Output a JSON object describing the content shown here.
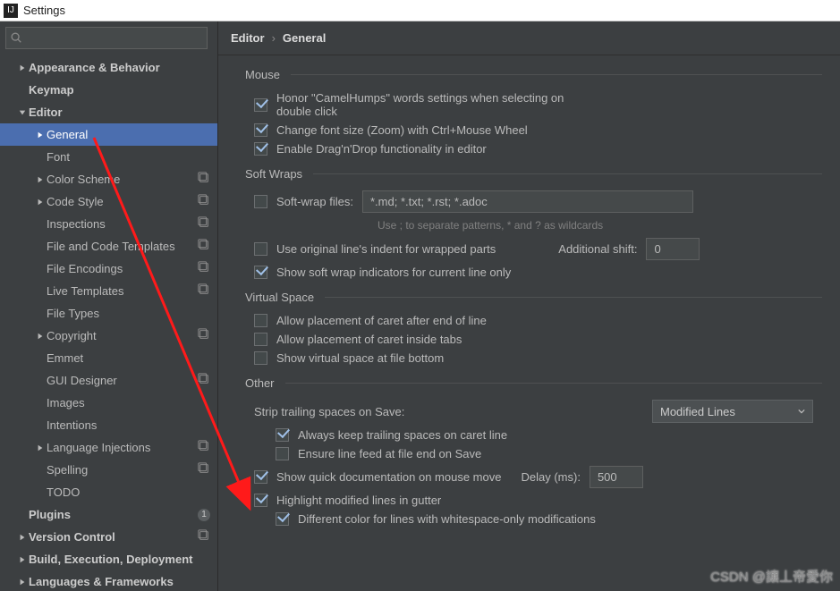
{
  "window": {
    "title": "Settings"
  },
  "search": {
    "placeholder": ""
  },
  "sidebar": {
    "items": [
      {
        "label": "Appearance & Behavior",
        "arrow": "right",
        "bold": true,
        "indent": 0
      },
      {
        "label": "Keymap",
        "bold": true,
        "indent": 0
      },
      {
        "label": "Editor",
        "arrow": "down",
        "bold": true,
        "indent": 0
      },
      {
        "label": "General",
        "arrow": "right",
        "indent": 1,
        "selected": true
      },
      {
        "label": "Font",
        "indent": 1
      },
      {
        "label": "Color Scheme",
        "arrow": "right",
        "indent": 1,
        "tag": true
      },
      {
        "label": "Code Style",
        "arrow": "right",
        "indent": 1,
        "tag": true
      },
      {
        "label": "Inspections",
        "indent": 1,
        "tag": true
      },
      {
        "label": "File and Code Templates",
        "indent": 1,
        "tag": true
      },
      {
        "label": "File Encodings",
        "indent": 1,
        "tag": true
      },
      {
        "label": "Live Templates",
        "indent": 1,
        "tag": true
      },
      {
        "label": "File Types",
        "indent": 1
      },
      {
        "label": "Copyright",
        "arrow": "right",
        "indent": 1,
        "tag": true
      },
      {
        "label": "Emmet",
        "indent": 1
      },
      {
        "label": "GUI Designer",
        "indent": 1,
        "tag": true
      },
      {
        "label": "Images",
        "indent": 1
      },
      {
        "label": "Intentions",
        "indent": 1
      },
      {
        "label": "Language Injections",
        "arrow": "right",
        "indent": 1,
        "tag": true
      },
      {
        "label": "Spelling",
        "indent": 1,
        "tag": true
      },
      {
        "label": "TODO",
        "indent": 1
      },
      {
        "label": "Plugins",
        "bold": true,
        "indent": 0,
        "badge": "1"
      },
      {
        "label": "Version Control",
        "arrow": "right",
        "bold": true,
        "indent": 0,
        "tag": true
      },
      {
        "label": "Build, Execution, Deployment",
        "arrow": "right",
        "bold": true,
        "indent": 0
      },
      {
        "label": "Languages & Frameworks",
        "arrow": "right",
        "bold": true,
        "indent": 0
      }
    ]
  },
  "breadcrumb": {
    "parent": "Editor",
    "current": "General"
  },
  "sections": {
    "mouse": {
      "title": "Mouse",
      "honor_line1": "Honor \"CamelHumps\" words settings when selecting on",
      "honor_line2": "double click",
      "change_font": "Change font size (Zoom) with Ctrl+Mouse Wheel",
      "dragdrop": "Enable Drag'n'Drop functionality in editor"
    },
    "softwraps": {
      "title": "Soft Wraps",
      "softwrap_files": "Soft-wrap files:",
      "softwrap_value": "*.md; *.txt; *.rst; *.adoc",
      "hint": "Use ; to separate patterns, * and ? as wildcards",
      "original_indent": "Use original line's indent for wrapped parts",
      "additional_shift": "Additional shift:",
      "additional_shift_value": "0",
      "show_indicators": "Show soft wrap indicators for current line only"
    },
    "virtual": {
      "title": "Virtual Space",
      "caret_eol": "Allow placement of caret after end of line",
      "caret_tabs": "Allow placement of caret inside tabs",
      "show_bottom": "Show virtual space at file bottom"
    },
    "other": {
      "title": "Other",
      "strip_label": "Strip trailing spaces on Save:",
      "strip_value": "Modified Lines",
      "keep_trailing": "Always keep trailing spaces on caret line",
      "ensure_lf": "Ensure line feed at file end on Save",
      "quick_doc": "Show quick documentation on mouse move",
      "delay_label": "Delay (ms):",
      "delay_value": "500",
      "highlight_gutter": "Highlight modified lines in gutter",
      "diff_color": "Different color for lines with whitespace-only modifications"
    }
  },
  "watermark": "CSDN @讓丄帝愛你"
}
